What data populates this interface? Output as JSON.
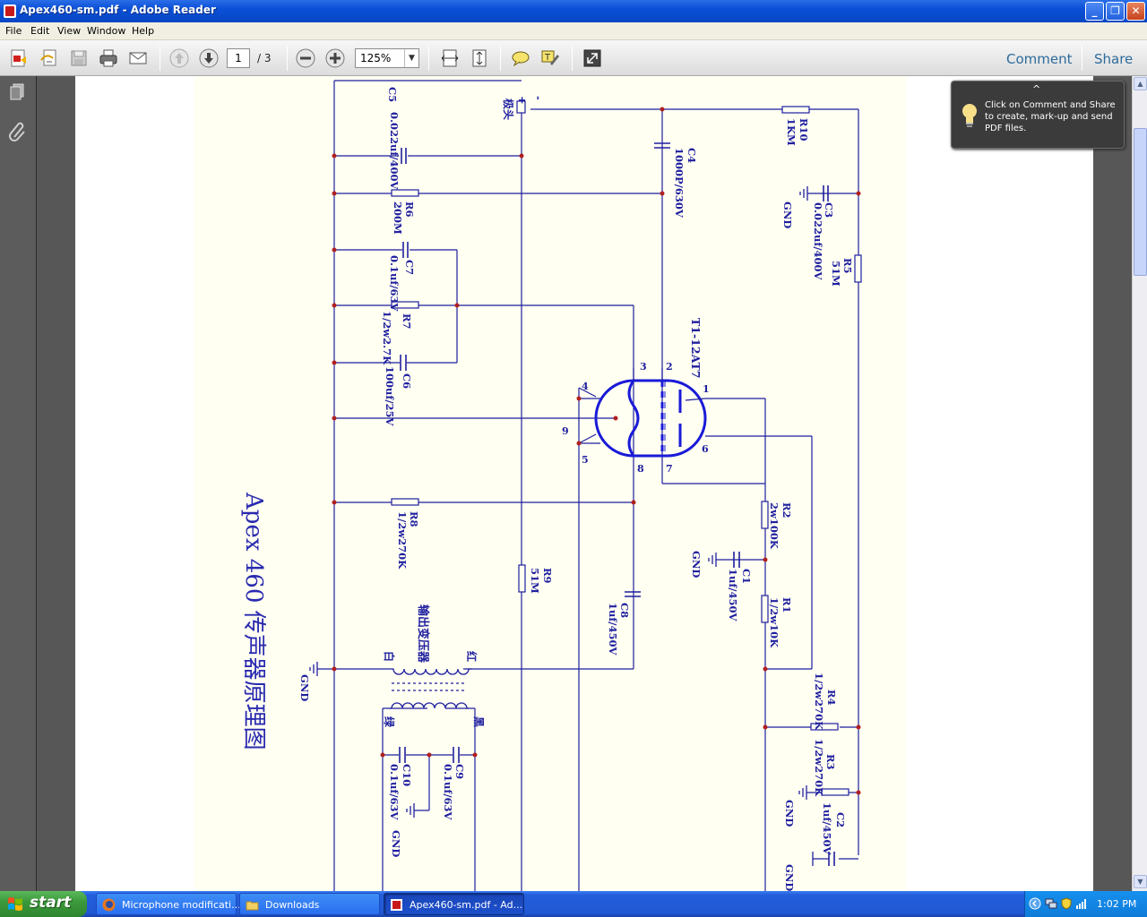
{
  "window": {
    "title": "Apex460-sm.pdf - Adobe Reader",
    "controls": [
      "minimize",
      "maximize",
      "close"
    ]
  },
  "menu": [
    "File",
    "Edit",
    "View",
    "Window",
    "Help"
  ],
  "toolbar": {
    "page_current": "1",
    "page_total": "/ 3",
    "zoom": "125%",
    "comment_label": "Comment",
    "share_label": "Share"
  },
  "tooltip": {
    "chevron": "^",
    "message": "Click on Comment and Share to create, mark-up and send PDF files."
  },
  "schematic": {
    "title": "Apex 460 传声器原理图",
    "tube_label": "T1-12AT7",
    "labels": {
      "c5": "C5",
      "c5v": "0.022uf/400V",
      "jitou": "极头",
      "c4": "C4",
      "c4v": "1000P/630V",
      "r10": "R10",
      "r10v": "1KM",
      "c3": "C3",
      "c3v": "0.022uf/400V",
      "gnd": "GND",
      "r6": "R6",
      "r6v": "200M",
      "r5": "R5",
      "r5v": "51M",
      "c7": "C7",
      "c7v": "0.1uf/63V",
      "r7": "R7",
      "r7v": "1/2w2.7K",
      "c6": "C6",
      "c6v": "100uf/25V",
      "r8": "R8",
      "r8v": "1/2w270K",
      "r9": "R9",
      "r9v": "51M",
      "c8": "C8",
      "c8v": "1uf/450V",
      "r2": "R2",
      "r2v": "2w100K",
      "c1": "C1",
      "c1v": "1uf/450V",
      "r1": "R1",
      "r1v": "1/2w10K",
      "r4": "R4",
      "r4v": "1/2w270K",
      "r3": "R3",
      "r3v": "1/2w270K",
      "c2": "C2",
      "c2v": "1uf/450V",
      "c10": "C10",
      "c10v": "0.1uf/63V",
      "c9": "C9",
      "c9v": "0.1uf/63V",
      "transformer": "输出变压器",
      "white": "白",
      "red": "红",
      "green": "绿",
      "black": "黑",
      "pin1": "1",
      "pin2": "2",
      "pin3": "3",
      "pin4": "4",
      "pin5": "5",
      "pin6": "6",
      "pin7": "7",
      "pin8": "8",
      "pin9": "9",
      "plus": "+",
      "minus": "-"
    }
  },
  "taskbar": {
    "start": "start",
    "tasks": [
      {
        "label": "Microphone modificati..."
      },
      {
        "label": "Downloads"
      },
      {
        "label": "Apex460-sm.pdf - Ad..."
      }
    ],
    "clock": "1:02 PM"
  }
}
